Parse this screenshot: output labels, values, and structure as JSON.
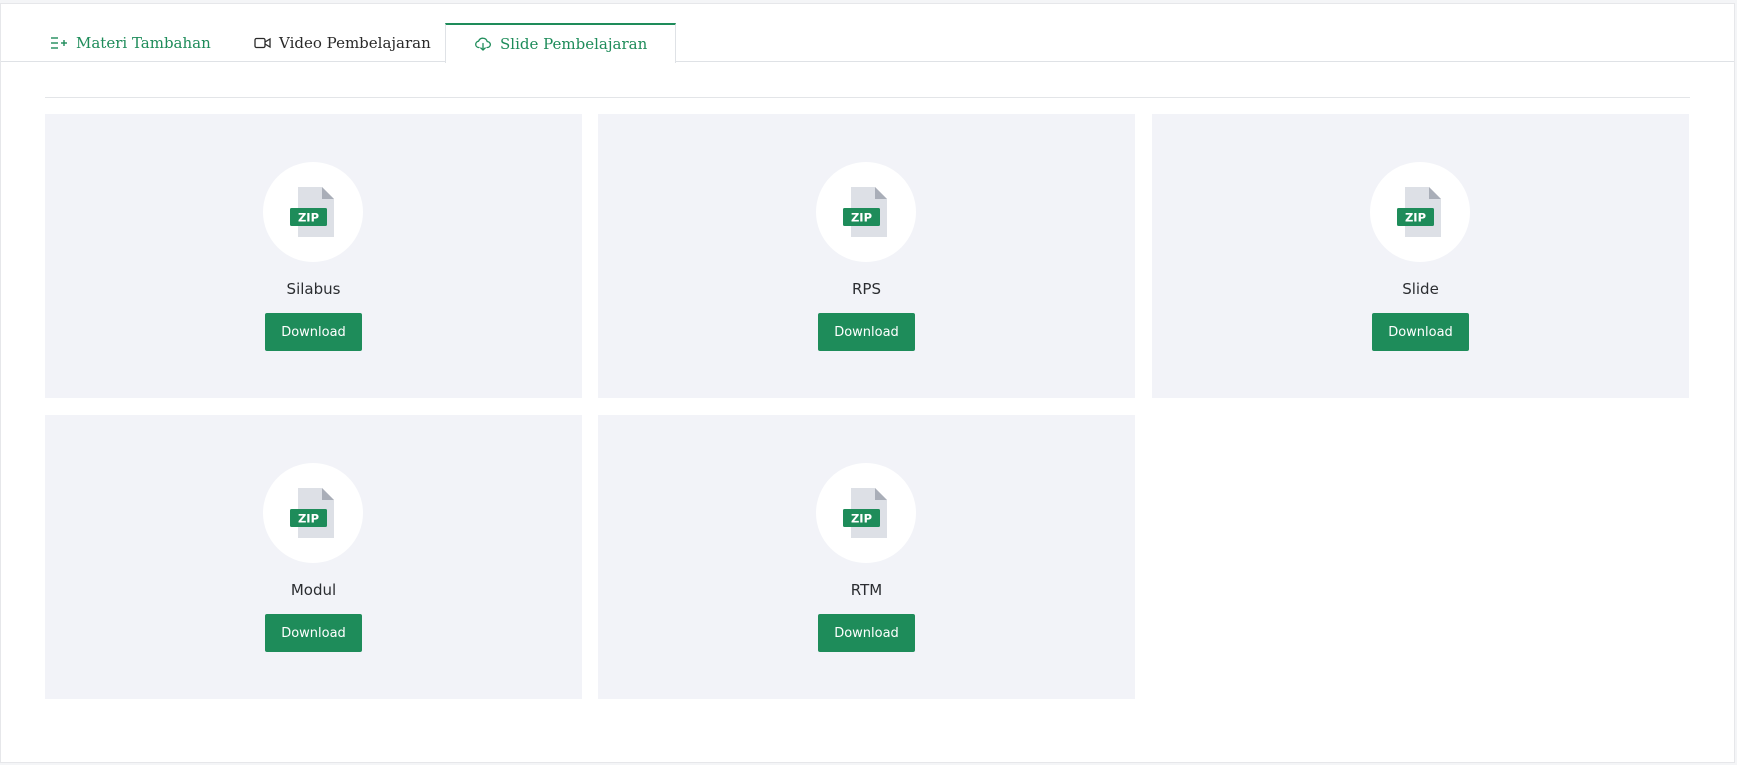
{
  "tabs": [
    {
      "label": "Materi Tambahan",
      "icon": "list-add-icon"
    },
    {
      "label": "Video Pembelajaran",
      "icon": "video-camera-icon"
    },
    {
      "label": "Slide Pembelajaran",
      "icon": "cloud-download-icon",
      "active": true
    }
  ],
  "files": [
    {
      "title": "Silabus",
      "badge": "ZIP",
      "button": "Download"
    },
    {
      "title": "RPS",
      "badge": "ZIP",
      "button": "Download"
    },
    {
      "title": "Slide",
      "badge": "ZIP",
      "button": "Download"
    },
    {
      "title": "Modul",
      "badge": "ZIP",
      "button": "Download"
    },
    {
      "title": "RTM",
      "badge": "ZIP",
      "button": "Download"
    }
  ],
  "colors": {
    "accent": "#1e8c5a",
    "card_background": "#f2f3f8",
    "file_icon": "#dde0e6"
  }
}
